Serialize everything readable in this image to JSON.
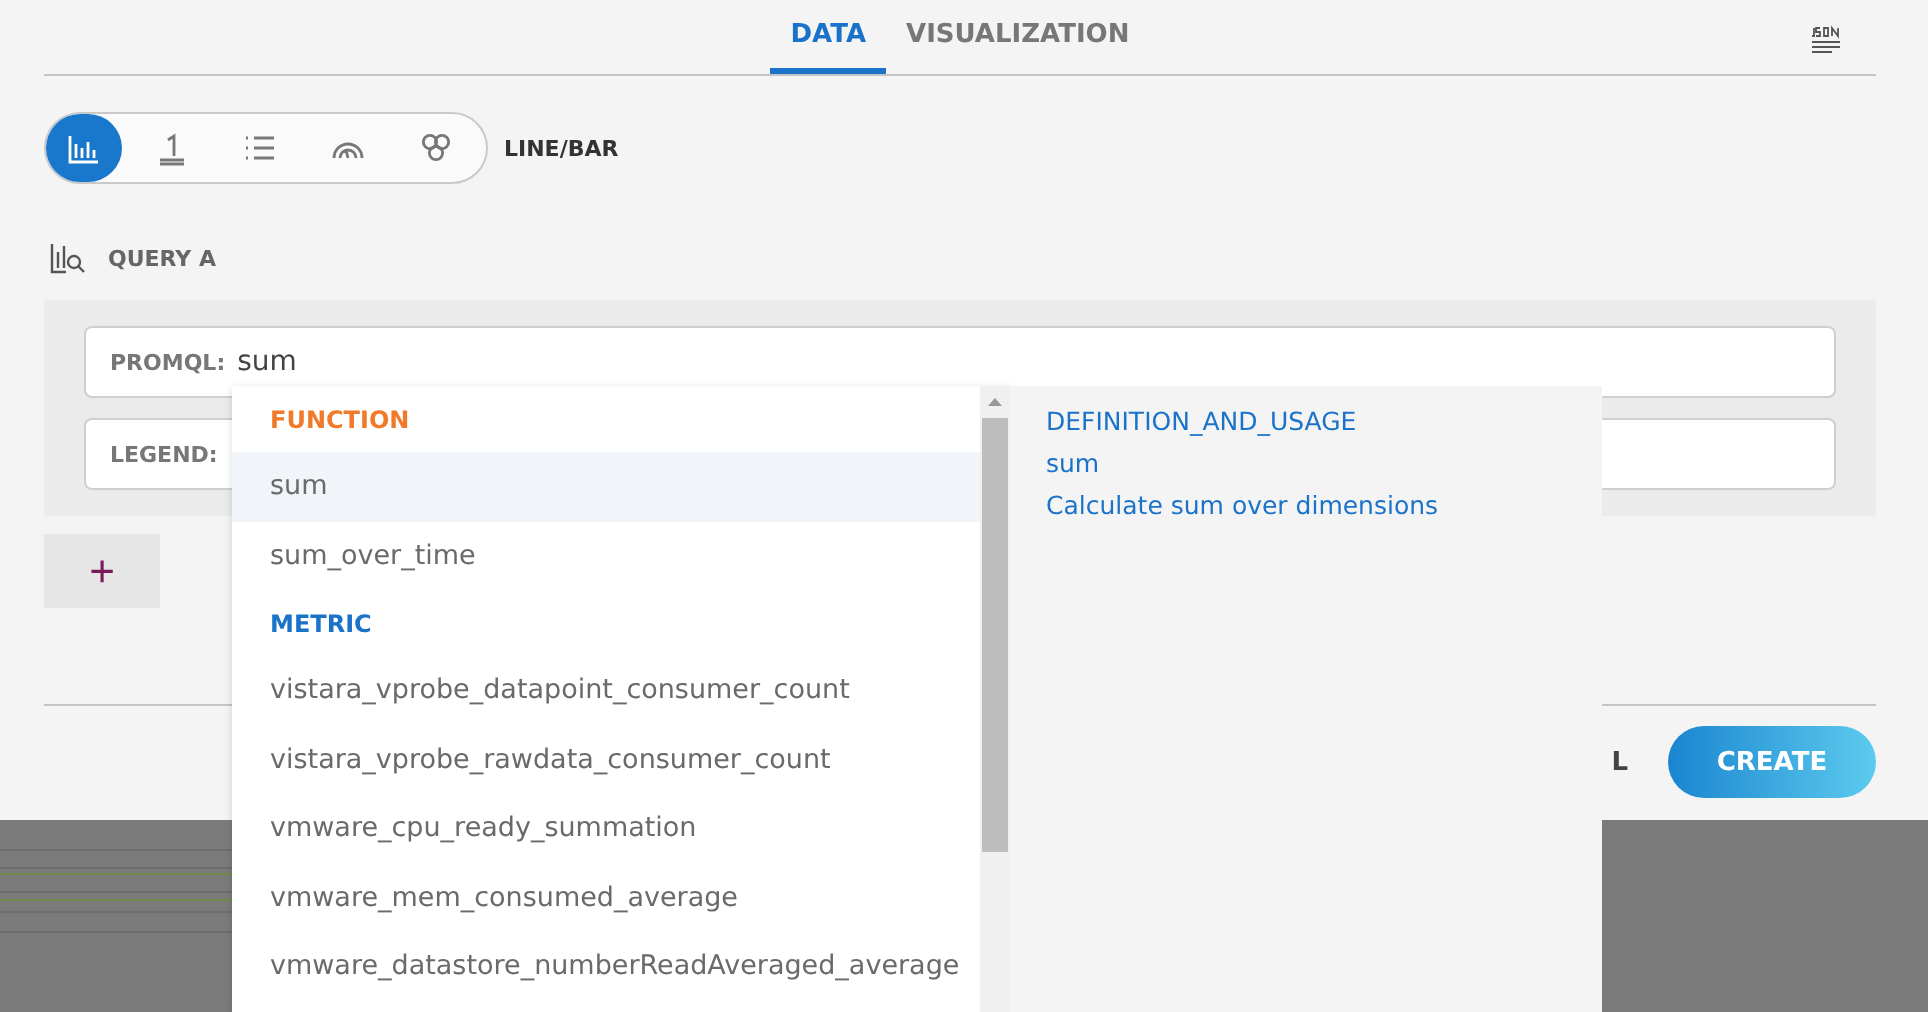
{
  "tabs": [
    {
      "label": "DATA",
      "selected": true
    },
    {
      "label": "VISUALIZATION",
      "selected": false
    }
  ],
  "chart_types": [
    {
      "kind": "bars",
      "selected": true
    },
    {
      "kind": "single",
      "selected": false
    },
    {
      "kind": "list",
      "selected": false
    },
    {
      "kind": "gauge",
      "selected": false
    },
    {
      "kind": "honeycomb",
      "selected": false
    }
  ],
  "chart_type_label": "LINE/BAR",
  "query": {
    "title": "QUERY A",
    "fields": [
      {
        "label": "PROMQL:",
        "value": "sum"
      },
      {
        "label": "LEGEND:"
      }
    ]
  },
  "add_button": "+",
  "footer_buttons": [
    {
      "label": "L",
      "kind": "text"
    },
    {
      "label": "CREATE",
      "kind": "primary"
    }
  ],
  "suggestions": [
    {
      "kind": "header",
      "label": "FUNCTION",
      "color": "#f07a2a"
    },
    {
      "kind": "item",
      "label": "sum",
      "selected": true
    },
    {
      "kind": "item",
      "label": "sum_over_time",
      "selected": false
    },
    {
      "kind": "header",
      "label": "METRIC",
      "color": "#1a73c8"
    },
    {
      "kind": "item",
      "label": "vistara_vprobe_datapoint_consumer_count",
      "selected": false
    },
    {
      "kind": "item",
      "label": "vistara_vprobe_rawdata_consumer_count",
      "selected": false
    },
    {
      "kind": "item",
      "label": "vmware_cpu_ready_summation",
      "selected": false
    },
    {
      "kind": "item",
      "label": "vmware_mem_consumed_average",
      "selected": false
    },
    {
      "kind": "item",
      "label": "vmware_datastore_numberReadAveraged_average",
      "selected": false
    }
  ],
  "definition": {
    "title": "DEFINITION_AND_USAGE",
    "name": "sum",
    "description": "Calculate sum over dimensions"
  }
}
